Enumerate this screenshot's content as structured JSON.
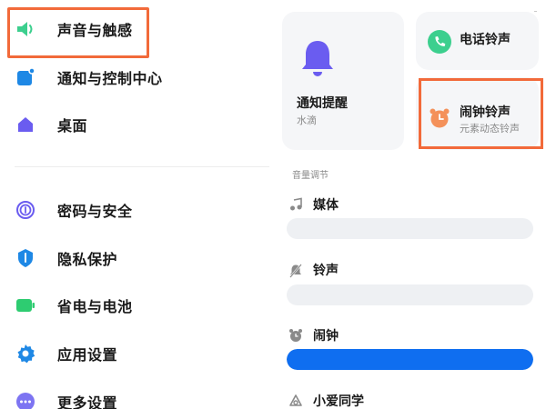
{
  "sidebar": {
    "items": [
      {
        "label": "声音与触感",
        "icon": "speaker-icon",
        "color": "#3ccf8e"
      },
      {
        "label": "通知与控制中心",
        "icon": "notification-icon",
        "color": "#1e88e5"
      },
      {
        "label": "桌面",
        "icon": "home-icon",
        "color": "#6a5cf0"
      },
      {
        "label": "密码与安全",
        "icon": "fingerprint-icon",
        "color": "#6a5cf0"
      },
      {
        "label": "隐私保护",
        "icon": "privacy-shield-icon",
        "color": "#1e88e5"
      },
      {
        "label": "省电与电池",
        "icon": "battery-icon",
        "color": "#2ecc71"
      },
      {
        "label": "应用设置",
        "icon": "gear-icon",
        "color": "#1e88e5"
      },
      {
        "label": "更多设置",
        "icon": "more-icon",
        "color": "#6a5cf0"
      }
    ]
  },
  "cards": {
    "notify": {
      "title": "通知提醒",
      "sub": "水滴",
      "icon": "bell-icon",
      "color": "#6a5cf0"
    },
    "call": {
      "title": "电话铃声",
      "icon": "phone-icon",
      "color": "#3ccf8e"
    },
    "alarm": {
      "title": "闹钟铃声",
      "sub": "元素动态铃声",
      "icon": "alarm-clock-icon",
      "color": "#f4915a"
    }
  },
  "volume": {
    "header": "音量调节",
    "rows": [
      {
        "label": "媒体",
        "icon": "music-note-icon",
        "level": 0
      },
      {
        "label": "铃声",
        "icon": "bell-muted-icon",
        "level": 0
      },
      {
        "label": "闹钟",
        "icon": "alarm-clock-icon",
        "level": 1.0
      },
      {
        "label": "小爱同学",
        "icon": "xiaoai-icon"
      }
    ]
  },
  "colors": {
    "accent": "#0f6ef0",
    "highlight": "#f26a3a"
  }
}
